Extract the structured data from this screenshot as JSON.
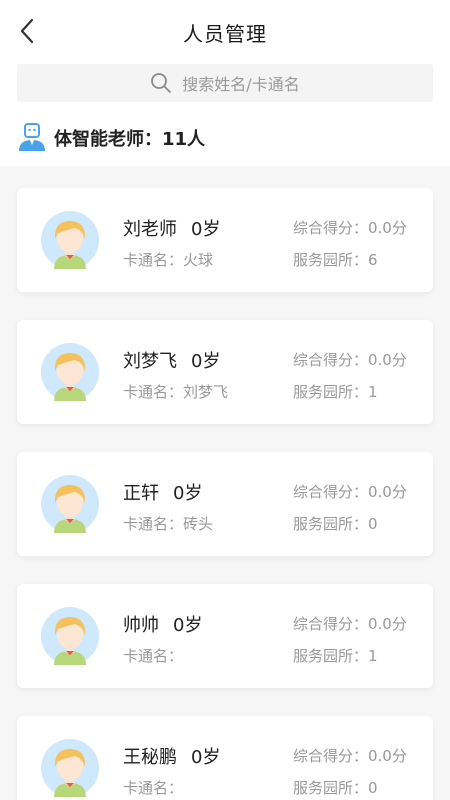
{
  "header": {
    "title": "人员管理",
    "back_icon": "chevron-left-icon"
  },
  "search": {
    "placeholder": "搜索姓名/卡通名",
    "icon": "search-icon"
  },
  "group": {
    "label": "体智能老师：11人",
    "icon": "teacher-icon"
  },
  "labels": {
    "card_name_prefix": "卡通名：",
    "score_prefix": "综合得分：",
    "parks_prefix": "服务园所："
  },
  "colors": {
    "accent_blue": "#4aa3e8",
    "avatar_bg": "#cfe8fb",
    "hair": "#f5c15d",
    "shirt": "#b7d77a"
  },
  "teachers": [
    {
      "name": "刘老师",
      "age": "0岁",
      "card_name": "卡通名：火球",
      "score": "综合得分：0.0分",
      "parks": "服务园所：6"
    },
    {
      "name": "刘梦飞",
      "age": "0岁",
      "card_name": "卡通名：刘梦飞",
      "score": "综合得分：0.0分",
      "parks": "服务园所：1"
    },
    {
      "name": "正轩",
      "age": "0岁",
      "card_name": "卡通名：砖头",
      "score": "综合得分：0.0分",
      "parks": "服务园所：0"
    },
    {
      "name": "帅帅",
      "age": "0岁",
      "card_name": "卡通名：",
      "score": "综合得分：0.0分",
      "parks": "服务园所：1"
    },
    {
      "name": "王秘鹏",
      "age": "0岁",
      "card_name": "卡通名：",
      "score": "综合得分：0.0分",
      "parks": "服务园所：0"
    }
  ]
}
